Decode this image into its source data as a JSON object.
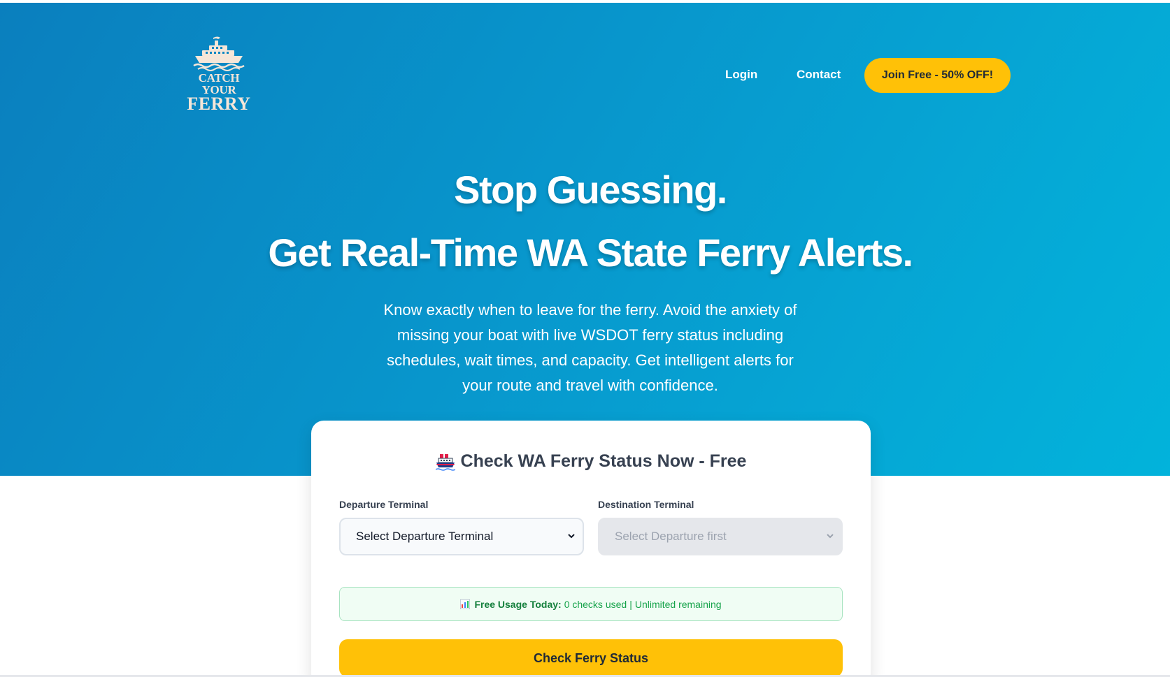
{
  "brand": {
    "line1": "CATCH YOUR",
    "line2": "FERRY",
    "logo_icon": "ferry-boat-icon",
    "logo_color": "#f6e6d8"
  },
  "nav": {
    "login": "Login",
    "contact": "Contact",
    "cta": "Join Free - 50% OFF!"
  },
  "hero": {
    "headline1": "Stop Guessing.",
    "headline2": "Get Real-Time WA State Ferry Alerts.",
    "lede": "Know exactly when to leave for the ferry. Avoid the anxiety of missing your boat with live WSDOT ferry status including schedules, wait times, and capacity. Get intelligent alerts for your route and travel with confidence."
  },
  "checker": {
    "title_icon": "ship-emoji-icon",
    "title": "Check WA Ferry Status Now - Free",
    "departure_label": "Departure Terminal",
    "departure_value": "Select Departure Terminal",
    "destination_label": "Destination Terminal",
    "destination_value": "Select Departure first",
    "usage_icon": "bar-chart-icon",
    "usage_label": "Free Usage Today:",
    "usage_used": "0 checks used",
    "usage_sep": "|",
    "usage_remaining": "Unlimited remaining",
    "button": "Check Ferry Status"
  },
  "colors": {
    "accent": "#ffc107",
    "hero_start": "#0a7fbe",
    "hero_end": "#02b3db",
    "success": "#16a34a"
  }
}
